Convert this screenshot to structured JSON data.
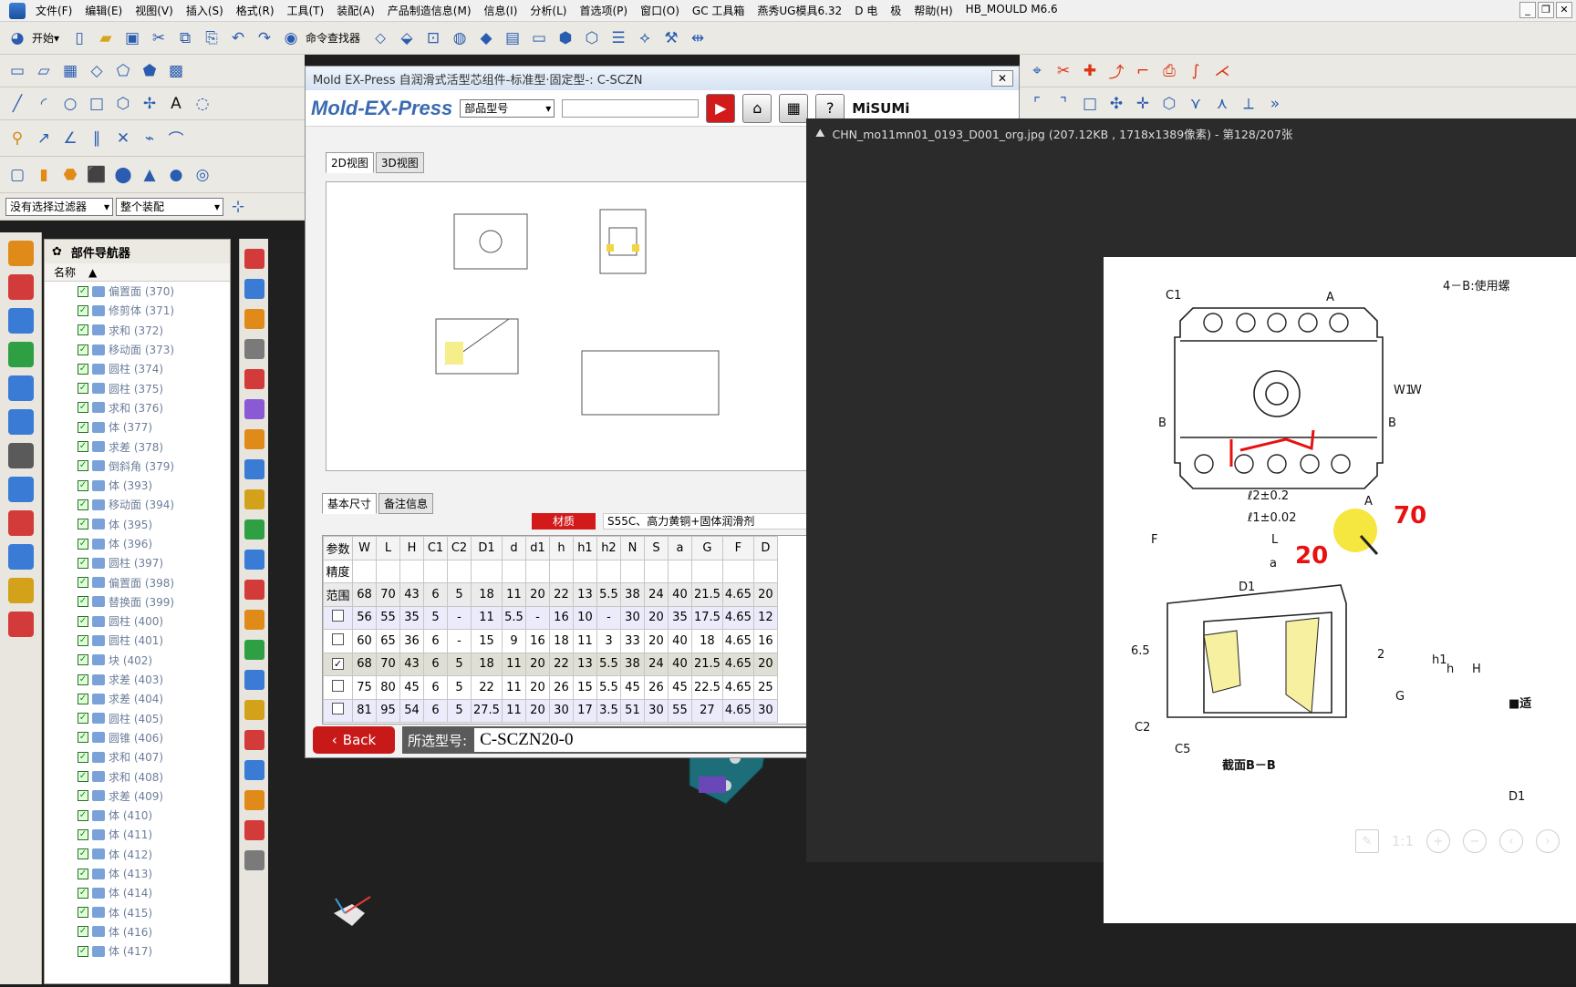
{
  "menu": {
    "items": [
      "文件(F)",
      "编辑(E)",
      "视图(V)",
      "插入(S)",
      "格式(R)",
      "工具(T)",
      "装配(A)",
      "产品制造信息(M)",
      "信息(I)",
      "分析(L)",
      "首选项(P)",
      "窗口(O)",
      "GC 工具箱",
      "燕秀UG模具6.32",
      "D 电",
      "极",
      "帮助(H)",
      "HB_MOULD M6.6"
    ]
  },
  "toolbar": {
    "start_label": "开始▾",
    "command_finder_label": "命令查找器",
    "filter_value": "没有选择过滤器",
    "assembly_value": "整个装配"
  },
  "navigator": {
    "title": "部件导航器",
    "column_header": "名称",
    "items": [
      "偏置面 (370)",
      "修剪体 (371)",
      "求和 (372)",
      "移动面 (373)",
      "圆柱 (374)",
      "圆柱 (375)",
      "求和 (376)",
      "体 (377)",
      "求差 (378)",
      "倒斜角 (379)",
      "体 (393)",
      "移动面 (394)",
      "体 (395)",
      "体 (396)",
      "圆柱 (397)",
      "偏置面 (398)",
      "替换面 (399)",
      "圆柱 (400)",
      "圆柱 (401)",
      "块 (402)",
      "求差 (403)",
      "求差 (404)",
      "圆柱 (405)",
      "圆锥 (406)",
      "求和 (407)",
      "求和 (408)",
      "求差 (409)",
      "体 (410)",
      "体 (411)",
      "体 (412)",
      "体 (413)",
      "体 (414)",
      "体 (415)",
      "体 (416)",
      "体 (417)"
    ]
  },
  "mold_window": {
    "title": "Mold EX-Press 自润滑式活型芯组件-标准型·固定型-: C-SCZN",
    "brand": "Mold-EX-Press",
    "part_type": "部品型号",
    "misumi_label": "MiSUMi",
    "view_tabs": [
      "2D视图",
      "3D视图"
    ],
    "data_tabs": [
      "基本尺寸",
      "备注信息"
    ],
    "material_label": "材质",
    "material_value": "S55C、高力黄铜+固体润滑剂",
    "back_label": "Back",
    "selected_label": "所选型号:",
    "selected_value": "C-SCZN20-0"
  },
  "spec_table": {
    "headers": [
      "参数",
      "W",
      "L",
      "H",
      "C1",
      "C2",
      "D1",
      "d",
      "d1",
      "h",
      "h1",
      "h2",
      "N",
      "S",
      "a",
      "G",
      "F",
      "D"
    ],
    "precision_label": "精度",
    "range_label": "范围",
    "range_values": [
      "68",
      "70",
      "43",
      "6",
      "5",
      "18",
      "11",
      "20",
      "22",
      "13",
      "5.5",
      "38",
      "24",
      "40",
      "21.5",
      "4.65",
      "20"
    ],
    "rows": [
      {
        "checked": false,
        "values": [
          "56",
          "55",
          "35",
          "5",
          "-",
          "11",
          "5.5",
          "-",
          "16",
          "10",
          "-",
          "30",
          "20",
          "35",
          "17.5",
          "4.65",
          "12"
        ]
      },
      {
        "checked": false,
        "values": [
          "60",
          "65",
          "36",
          "6",
          "-",
          "15",
          "9",
          "16",
          "18",
          "11",
          "3",
          "33",
          "20",
          "40",
          "18",
          "4.65",
          "16"
        ]
      },
      {
        "checked": true,
        "values": [
          "68",
          "70",
          "43",
          "6",
          "5",
          "18",
          "11",
          "20",
          "22",
          "13",
          "5.5",
          "38",
          "24",
          "40",
          "21.5",
          "4.65",
          "20"
        ]
      },
      {
        "checked": false,
        "values": [
          "75",
          "80",
          "45",
          "6",
          "5",
          "22",
          "11",
          "20",
          "26",
          "15",
          "5.5",
          "45",
          "26",
          "45",
          "22.5",
          "4.65",
          "25"
        ]
      },
      {
        "checked": false,
        "values": [
          "81",
          "95",
          "54",
          "6",
          "5",
          "27.5",
          "11",
          "20",
          "30",
          "17",
          "3.5",
          "51",
          "30",
          "55",
          "27",
          "4.65",
          "30"
        ]
      }
    ]
  },
  "viewer": {
    "title": "CHN_mo11mn01_0193_D001_org.jpg (207.12KB , 1718x1389像素) - 第128/207张",
    "drawing_labels": {
      "top_right": "4－B:使用螺",
      "section": "截面B－B",
      "dim_l2": "ℓ2±0.2",
      "dim_l1": "ℓ1±0.02",
      "dim_L": "L",
      "dim_F": "F",
      "dim_W": "W",
      "dim_W1": "W1",
      "dim_a": "a",
      "dim_D1": "D1",
      "dim_H": "H",
      "dim_h": "h",
      "dim_h1": "h1",
      "dim_G": "G",
      "dim_C1": "C1",
      "dim_C2": "C2",
      "dim_C5": "C5",
      "dim_65": "6.5",
      "dim_2": "2",
      "mark_B": "B",
      "mark_A": "A",
      "right_mark": "■适",
      "right_D1": "D1"
    },
    "handwritten": [
      "70",
      "20"
    ],
    "controls": [
      "1:1"
    ]
  },
  "colors": {
    "accent_red": "#d21a1a",
    "row_tint": "#ecebfb",
    "title_blue": "#3a6bb0"
  }
}
